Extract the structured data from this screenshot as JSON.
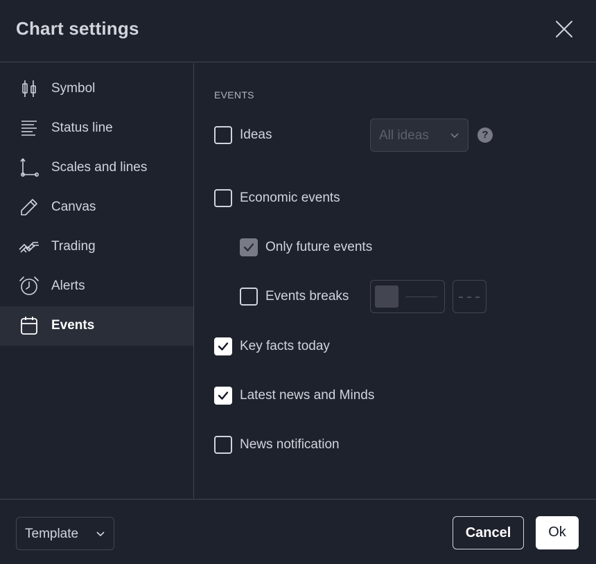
{
  "dialog": {
    "title": "Chart settings",
    "close_icon": "close-icon"
  },
  "sidebar": {
    "items": [
      {
        "label": "Symbol",
        "icon": "candlestick-icon",
        "active": false
      },
      {
        "label": "Status line",
        "icon": "status-line-icon",
        "active": false
      },
      {
        "label": "Scales and lines",
        "icon": "scales-icon",
        "active": false
      },
      {
        "label": "Canvas",
        "icon": "pencil-icon",
        "active": false
      },
      {
        "label": "Trading",
        "icon": "trading-icon",
        "active": false
      },
      {
        "label": "Alerts",
        "icon": "alarm-clock-icon",
        "active": false
      },
      {
        "label": "Events",
        "icon": "calendar-icon",
        "active": true
      }
    ]
  },
  "events": {
    "section_title": "EVENTS",
    "ideas": {
      "label": "Ideas",
      "checked": false,
      "select_value": "All ideas",
      "help": "?"
    },
    "economic_events": {
      "label": "Economic events",
      "checked": false
    },
    "only_future_events": {
      "label": "Only future events",
      "checked": true,
      "disabled": true
    },
    "events_breaks": {
      "label": "Events breaks",
      "checked": false
    },
    "key_facts_today": {
      "label": "Key facts today",
      "checked": true
    },
    "latest_news": {
      "label": "Latest news and Minds",
      "checked": true
    },
    "news_notification": {
      "label": "News notification",
      "checked": false
    }
  },
  "footer": {
    "template_label": "Template",
    "cancel_label": "Cancel",
    "ok_label": "Ok"
  },
  "colors": {
    "background": "#1e222d",
    "border": "#434651",
    "active_item": "#2a2e39",
    "text": "#d1d4dc",
    "muted": "#787b86"
  }
}
